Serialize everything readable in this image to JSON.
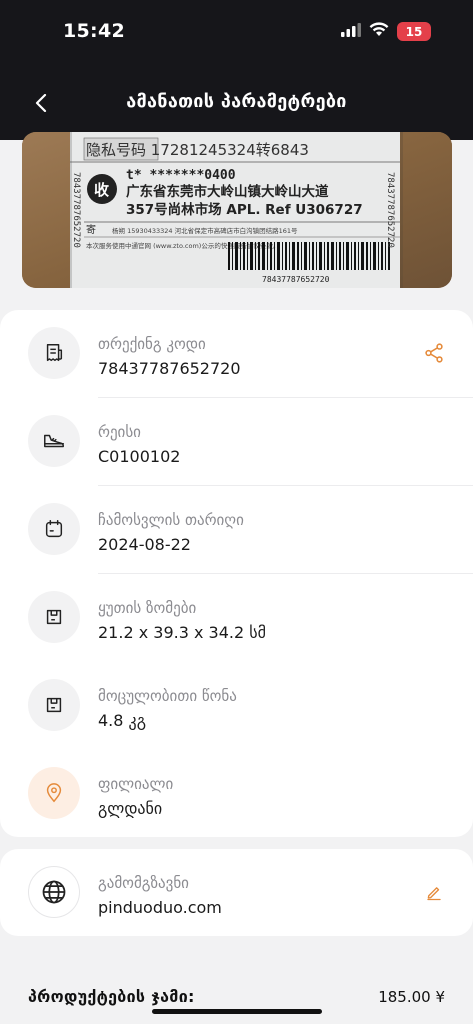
{
  "status_bar": {
    "time": "15:42",
    "battery": "15",
    "icons": [
      "signal-icon",
      "wifi-icon"
    ]
  },
  "header": {
    "title": "ამანათის პარამეტრები",
    "back_icon": "chevron-left-icon"
  },
  "label_photo": {
    "line1": "隐私号码 17281245324转6843",
    "line2": "t* *******0400",
    "line3": "广东省东莞市大岭山镇大岭山大道",
    "line4": "357号尚林市场 APL. Ref U306727",
    "stamp": "收",
    "side_code": "78437787652720",
    "small_left": "本次服务使用中通官网 (www.zto.com)公示的快递服务协议条款。",
    "sender_tag": "寄",
    "sender_info": "杨朔 15930433324  河北省保定市高碑店市白沟镇团结路161号",
    "barcode_number": "78437787652720"
  },
  "details": [
    {
      "label": "თრექინგ კოდი",
      "value": "78437787652720",
      "icon": "receipt-icon",
      "action_icon": "share-icon"
    },
    {
      "label": "რეისი",
      "value": "C0100102",
      "icon": "shoe-icon"
    },
    {
      "label": "ჩამოსვლის თარიღი",
      "value": "2024-08-22",
      "icon": "calendar-icon"
    },
    {
      "label": "ყუთის ზომები",
      "value": "21.2 x 39.3 x 34.2 სმ",
      "icon": "package-icon"
    },
    {
      "label": "მოცულობითი წონა",
      "value": "4.8 კგ",
      "icon": "package-icon"
    },
    {
      "label": "ფილიალი",
      "value": "გლდანი",
      "icon": "location-pin-icon"
    }
  ],
  "sender": {
    "label": "გამომგზავნი",
    "value": "pinduoduo.com",
    "icon": "globe-icon",
    "action_icon": "edit-icon"
  },
  "total": {
    "label": "პროდუქტების ჯამი:",
    "value": "185.00 ¥"
  },
  "colors": {
    "accent": "#e58a3a",
    "header_bg": "#16161a",
    "page_bg": "#f2f2f3"
  }
}
